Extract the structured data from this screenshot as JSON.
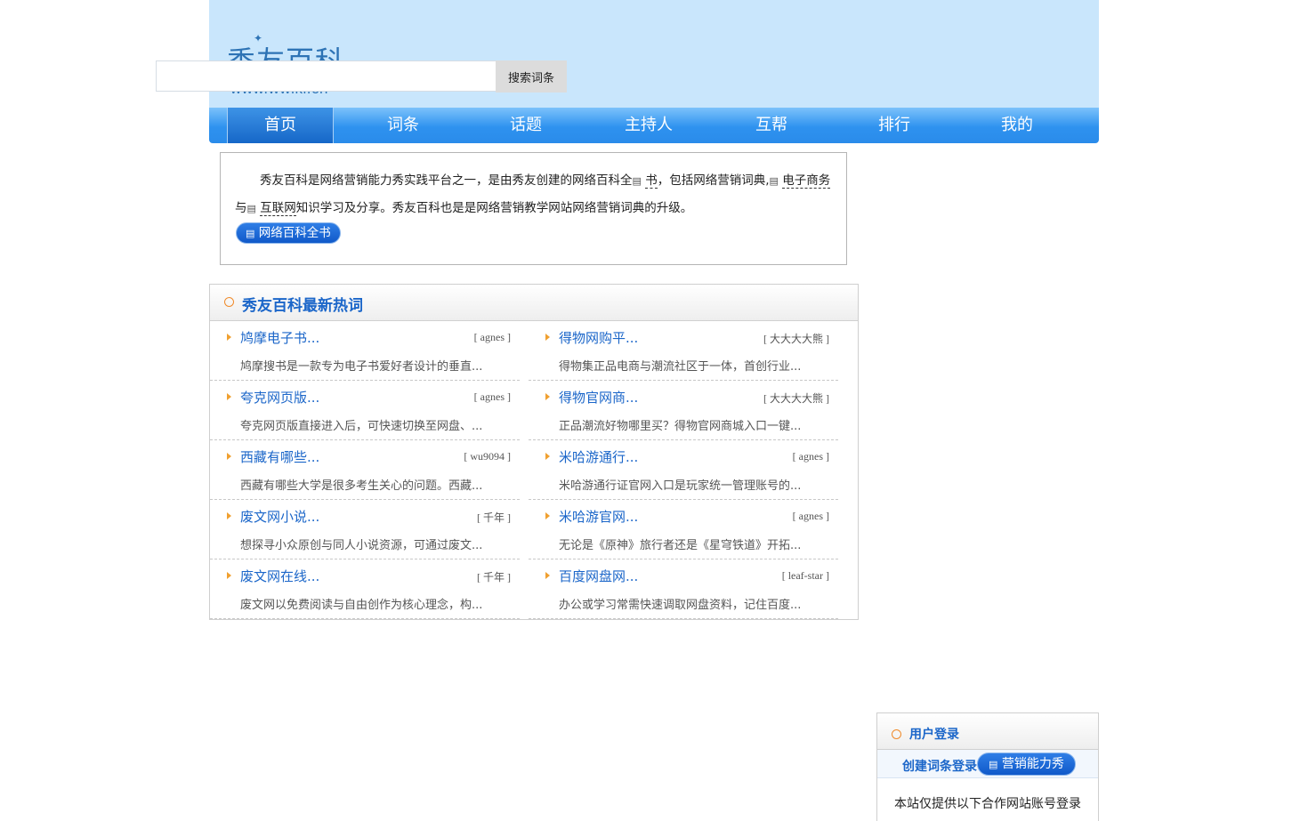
{
  "header": {
    "logo_text": "秀友百科",
    "logo_url": "www.wwiki.cn",
    "search_placeholder": "",
    "search_button": "搜索词条"
  },
  "nav": {
    "items": [
      {
        "label": "首页",
        "active": true
      },
      {
        "label": "词条"
      },
      {
        "label": "话题"
      },
      {
        "label": "主持人"
      },
      {
        "label": "互帮"
      },
      {
        "label": "排行"
      },
      {
        "label": "我的"
      }
    ]
  },
  "intro": {
    "part1": "秀友百科是网络营销能力秀实践平台之一，是由秀友创建的网络百科全",
    "link1": "书",
    "part2": "，包括网络营销词典,",
    "link2": "电子商务",
    "part3": "与",
    "link3": "互联网",
    "part4": "知识学习及分享。秀友百科也是是网络营销教学网站网络营销词典的升级。",
    "button": "网络百科全书"
  },
  "hot": {
    "title": "秀友百科最新热词",
    "entries": [
      {
        "title": "鸠摩电子书...",
        "user": "[ agnes ]",
        "desc": "鸠摩搜书是一款专为电子书爱好者设计的垂直..."
      },
      {
        "title": "得物网购平...",
        "user": "[ 大大大大熊 ]",
        "desc": "得物集正品电商与潮流社区于一体，首创行业..."
      },
      {
        "title": "夸克网页版...",
        "user": "[ agnes ]",
        "desc": "夸克网页版直接进入后，可快速切换至网盘、..."
      },
      {
        "title": "得物官网商...",
        "user": "[ 大大大大熊 ]",
        "desc": "正品潮流好物哪里买？得物官网商城入口一键..."
      },
      {
        "title": "西藏有哪些...",
        "user": "[ wu9094 ]",
        "desc": "西藏有哪些大学是很多考生关心的问题。西藏..."
      },
      {
        "title": "米哈游通行...",
        "user": "[ agnes ]",
        "desc": "米哈游通行证官网入口是玩家统一管理账号的..."
      },
      {
        "title": "废文网小说...",
        "user": "[ 千年 ]",
        "desc": "想探寻小众原创与同人小说资源，可通过废文..."
      },
      {
        "title": "米哈游官网...",
        "user": "[ agnes ]",
        "desc": "无论是《原神》旅行者还是《星穹铁道》开拓..."
      },
      {
        "title": "废文网在线...",
        "user": "[ 千年 ]",
        "desc": "废文网以免费阅读与自由创作为核心理念，构..."
      },
      {
        "title": "百度网盘网...",
        "user": "[ leaf-star ]",
        "desc": "办公或学习常需快速调取网盘资料，记住百度..."
      }
    ]
  },
  "login": {
    "title": "用户登录",
    "create_link": "创建词条登录",
    "button": "营销能力秀",
    "note": "本站仅提供以下合作网站账号登录"
  },
  "colors": {
    "header_bg": "#c9e6fc",
    "nav_blue": "#2e92ef",
    "link_blue": "#1b66c9",
    "accent_orange": "#f08a2a"
  }
}
